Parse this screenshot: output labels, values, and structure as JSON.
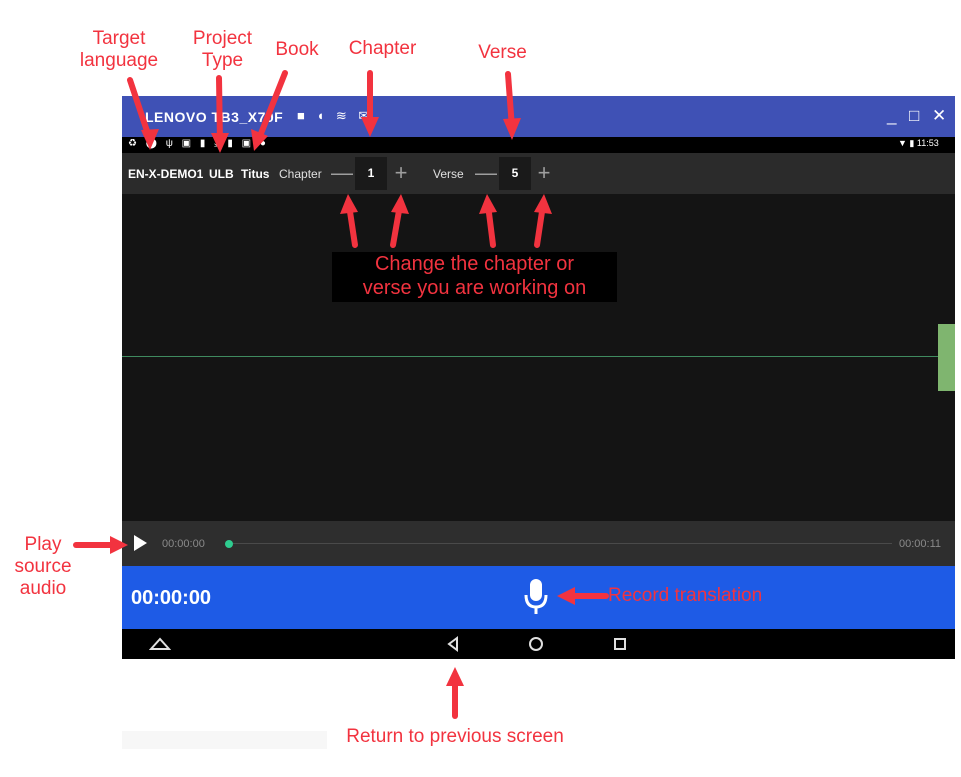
{
  "window": {
    "title": "LENOVO TB3_X70F",
    "minimize_glyph": "_",
    "maximize_glyph": "□",
    "close_glyph": "✕"
  },
  "statusbar": {
    "icons": "♻ ⬤ ψ ▣ ▮ ⤓ ▮ ▣ ●",
    "signal_battery": "▼ ▮",
    "clock": "11:53"
  },
  "toolbar": {
    "language": "EN-X-DEMO1",
    "project_type": "ULB",
    "book": "Titus",
    "chapter_label": "Chapter",
    "chapter_value": "1",
    "verse_label": "Verse",
    "verse_value": "5",
    "minus_glyph": "—",
    "plus_glyph": "+"
  },
  "playback": {
    "current_time": "00:00:00",
    "total_time": "00:00:11",
    "progress": 0
  },
  "record": {
    "elapsed": "00:00:00"
  },
  "annotations": {
    "target_language": "Target\nlanguage",
    "project_type": "Project\nType",
    "book": "Book",
    "chapter": "Chapter",
    "verse": "Verse",
    "change_hint": "Change the chapter or\nverse you are working on",
    "play_source": "Play\nsource\naudio",
    "record_translation": "Record translation",
    "return_previous": "Return to previous screen"
  },
  "colors": {
    "annotation": "#f2333f",
    "titlebar": "#3f51b5",
    "record_bar": "#1e5be6",
    "progress_dot": "#2ecc8f",
    "waveform_line": "#3f8a5f",
    "marker": "#7fb56f"
  },
  "icons": {
    "play": "play-icon",
    "mic": "microphone-icon",
    "nav_home": "home-icon",
    "nav_back": "back-icon",
    "nav_circle": "circle-home-icon",
    "nav_recents": "recents-icon"
  }
}
